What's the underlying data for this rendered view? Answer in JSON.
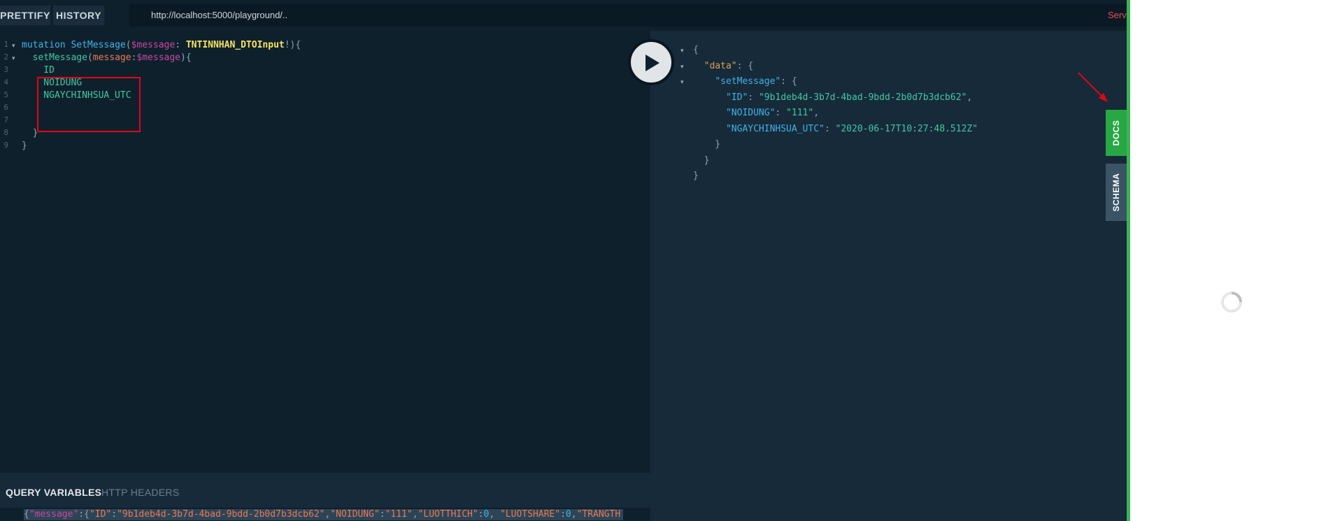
{
  "toolbar": {
    "prettify_label": "PRETTIFY",
    "history_label": "HISTORY"
  },
  "url": {
    "value": "http://localhost:5000/playground/.."
  },
  "server_text": "Serv",
  "editor": {
    "line_numbers": [
      "1",
      "2",
      "3",
      "4",
      "5",
      "6",
      "7",
      "8",
      "9"
    ],
    "lines": [
      [
        {
          "t": "mutation ",
          "c": "k"
        },
        {
          "t": "SetMessage",
          "c": "op"
        },
        {
          "t": "(",
          "c": "p"
        },
        {
          "t": "$message",
          "c": "v"
        },
        {
          "t": ": ",
          "c": "p"
        },
        {
          "t": "TNTINNHAN_DTOInput",
          "c": "t"
        },
        {
          "t": "!){",
          "c": "p"
        }
      ],
      [
        {
          "t": "  ",
          "c": "p"
        },
        {
          "t": "setMessage",
          "c": "f"
        },
        {
          "t": "(",
          "c": "p"
        },
        {
          "t": "message",
          "c": "a"
        },
        {
          "t": ":",
          "c": "p"
        },
        {
          "t": "$message",
          "c": "v"
        },
        {
          "t": "){",
          "c": "p"
        }
      ],
      [
        {
          "t": "    ID",
          "c": "f"
        }
      ],
      [
        {
          "t": "    NOIDUNG",
          "c": "f"
        }
      ],
      [
        {
          "t": "    NGAYCHINHSUA_UTC",
          "c": "f"
        }
      ],
      [],
      [],
      [
        {
          "t": "  }",
          "c": "p"
        }
      ],
      [
        {
          "t": "}",
          "c": "p"
        }
      ]
    ]
  },
  "result": {
    "lines": [
      [
        {
          "t": "{",
          "c": "p"
        }
      ],
      [
        {
          "t": "  ",
          "c": "p"
        },
        {
          "t": "\"data\"",
          "c": "key2"
        },
        {
          "t": ": {",
          "c": "p"
        }
      ],
      [
        {
          "t": "    ",
          "c": "p"
        },
        {
          "t": "\"setMessage\"",
          "c": "key"
        },
        {
          "t": ": {",
          "c": "p"
        }
      ],
      [
        {
          "t": "      ",
          "c": "p"
        },
        {
          "t": "\"ID\"",
          "c": "key"
        },
        {
          "t": ": ",
          "c": "p"
        },
        {
          "t": "\"9b1deb4d-3b7d-4bad-9bdd-2b0d7b3dcb62\"",
          "c": "str"
        },
        {
          "t": ",",
          "c": "p"
        }
      ],
      [
        {
          "t": "      ",
          "c": "p"
        },
        {
          "t": "\"NOIDUNG\"",
          "c": "key"
        },
        {
          "t": ": ",
          "c": "p"
        },
        {
          "t": "\"111\"",
          "c": "str"
        },
        {
          "t": ",",
          "c": "p"
        }
      ],
      [
        {
          "t": "      ",
          "c": "p"
        },
        {
          "t": "\"NGAYCHINHSUA_UTC\"",
          "c": "key"
        },
        {
          "t": ": ",
          "c": "p"
        },
        {
          "t": "\"2020-06-17T10:27:48.512Z\"",
          "c": "str"
        }
      ],
      [
        {
          "t": "    }",
          "c": "p"
        }
      ],
      [
        {
          "t": "  }",
          "c": "p"
        }
      ],
      [
        {
          "t": "}",
          "c": "p"
        }
      ]
    ]
  },
  "tabs": {
    "query_variables": "QUERY VARIABLES",
    "http_headers": "HTTP HEADERS"
  },
  "variables_line": [
    {
      "t": "{",
      "c": "p"
    },
    {
      "t": "\"message\"",
      "c": "v"
    },
    {
      "t": ":{",
      "c": "p"
    },
    {
      "t": "\"ID\"",
      "c": "a"
    },
    {
      "t": ":",
      "c": "p"
    },
    {
      "t": "\"9b1deb4d-3b7d-4bad-9bdd-2b0d7b3dcb62\"",
      "c": "a"
    },
    {
      "t": ",",
      "c": "p"
    },
    {
      "t": "\"NOIDUNG\"",
      "c": "a"
    },
    {
      "t": ":",
      "c": "p"
    },
    {
      "t": "\"111\"",
      "c": "a"
    },
    {
      "t": ",",
      "c": "p"
    },
    {
      "t": "\"LUOTTHICH\"",
      "c": "a"
    },
    {
      "t": ":",
      "c": "p"
    },
    {
      "t": "0",
      "c": "k"
    },
    {
      "t": ", ",
      "c": "p"
    },
    {
      "t": "\"LUOTSHARE\"",
      "c": "a"
    },
    {
      "t": ":",
      "c": "p"
    },
    {
      "t": "0",
      "c": "k"
    },
    {
      "t": ",",
      "c": "p"
    },
    {
      "t": "\"TRANGTH",
      "c": "a"
    }
  ],
  "side_tabs": {
    "docs": "DOCS",
    "schema": "SCHEMA"
  },
  "colors": {
    "accent_green": "#3ab454",
    "docs_tab": "#28a745",
    "schema_tab": "#3a5466",
    "annotation_red": "#e30613",
    "background": "#172a3a",
    "editor_bg": "#0f202d"
  },
  "icons": {
    "play": "play-icon",
    "spinner": "spinner-icon",
    "fold": "fold-arrow-icon",
    "annotation": "red-arrow-icon"
  }
}
